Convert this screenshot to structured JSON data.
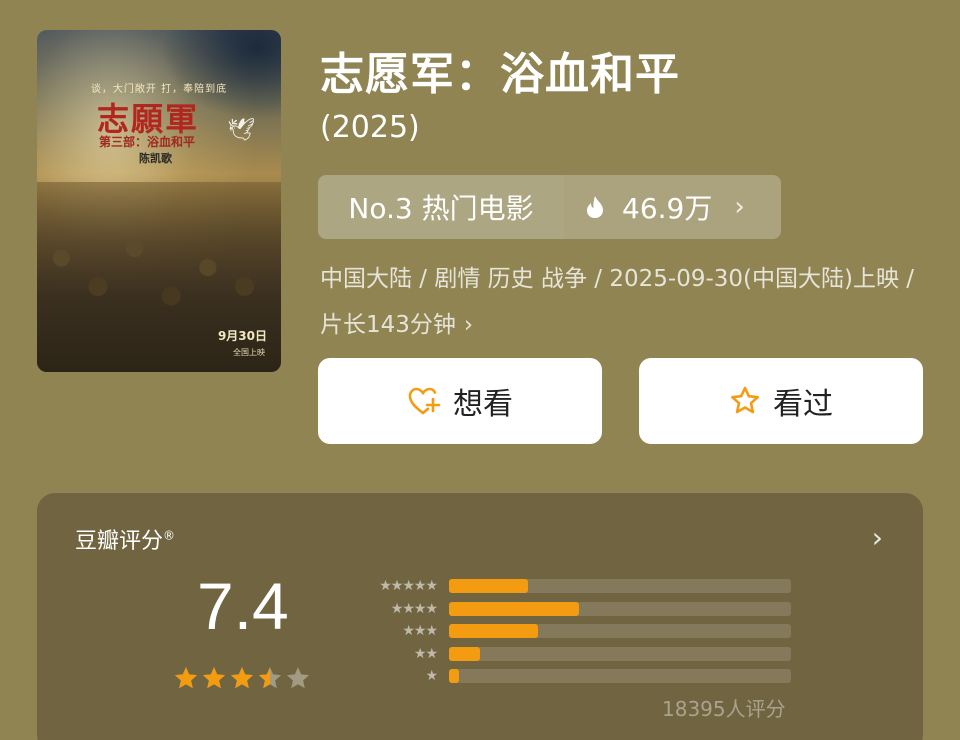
{
  "movie": {
    "title": "志愿军：浴血和平",
    "year": "(2025)",
    "poster": {
      "slogan": "谈，大门敞开  打，奉陪到底",
      "title": "志願軍",
      "subtitle": "第三部：浴血和平",
      "director": "陈凯歌",
      "date": "9月30日",
      "date_sub": "全国上映"
    }
  },
  "rank": {
    "label": "No.3 热门电影",
    "heat": "46.9万",
    "heat_icon": "flame-icon"
  },
  "meta": {
    "line": "中国大陆 / 剧情 历史 战争 / 2025-09-30(中国大陆)上映 / 片长143分钟"
  },
  "actions": {
    "want_label": "想看",
    "seen_label": "看过"
  },
  "rating": {
    "label": "豆瓣评分",
    "mark": "®",
    "score": "7.4",
    "stars": 3.5,
    "distribution": [
      {
        "stars": 5,
        "value": 0.23
      },
      {
        "stars": 4,
        "value": 0.38
      },
      {
        "stars": 3,
        "value": 0.26
      },
      {
        "stars": 2,
        "value": 0.09
      },
      {
        "stars": 1,
        "value": 0.03
      }
    ],
    "count": "18395人评分"
  },
  "colors": {
    "background": "#8f8452",
    "card": "#706540",
    "accent": "#f39c12"
  }
}
